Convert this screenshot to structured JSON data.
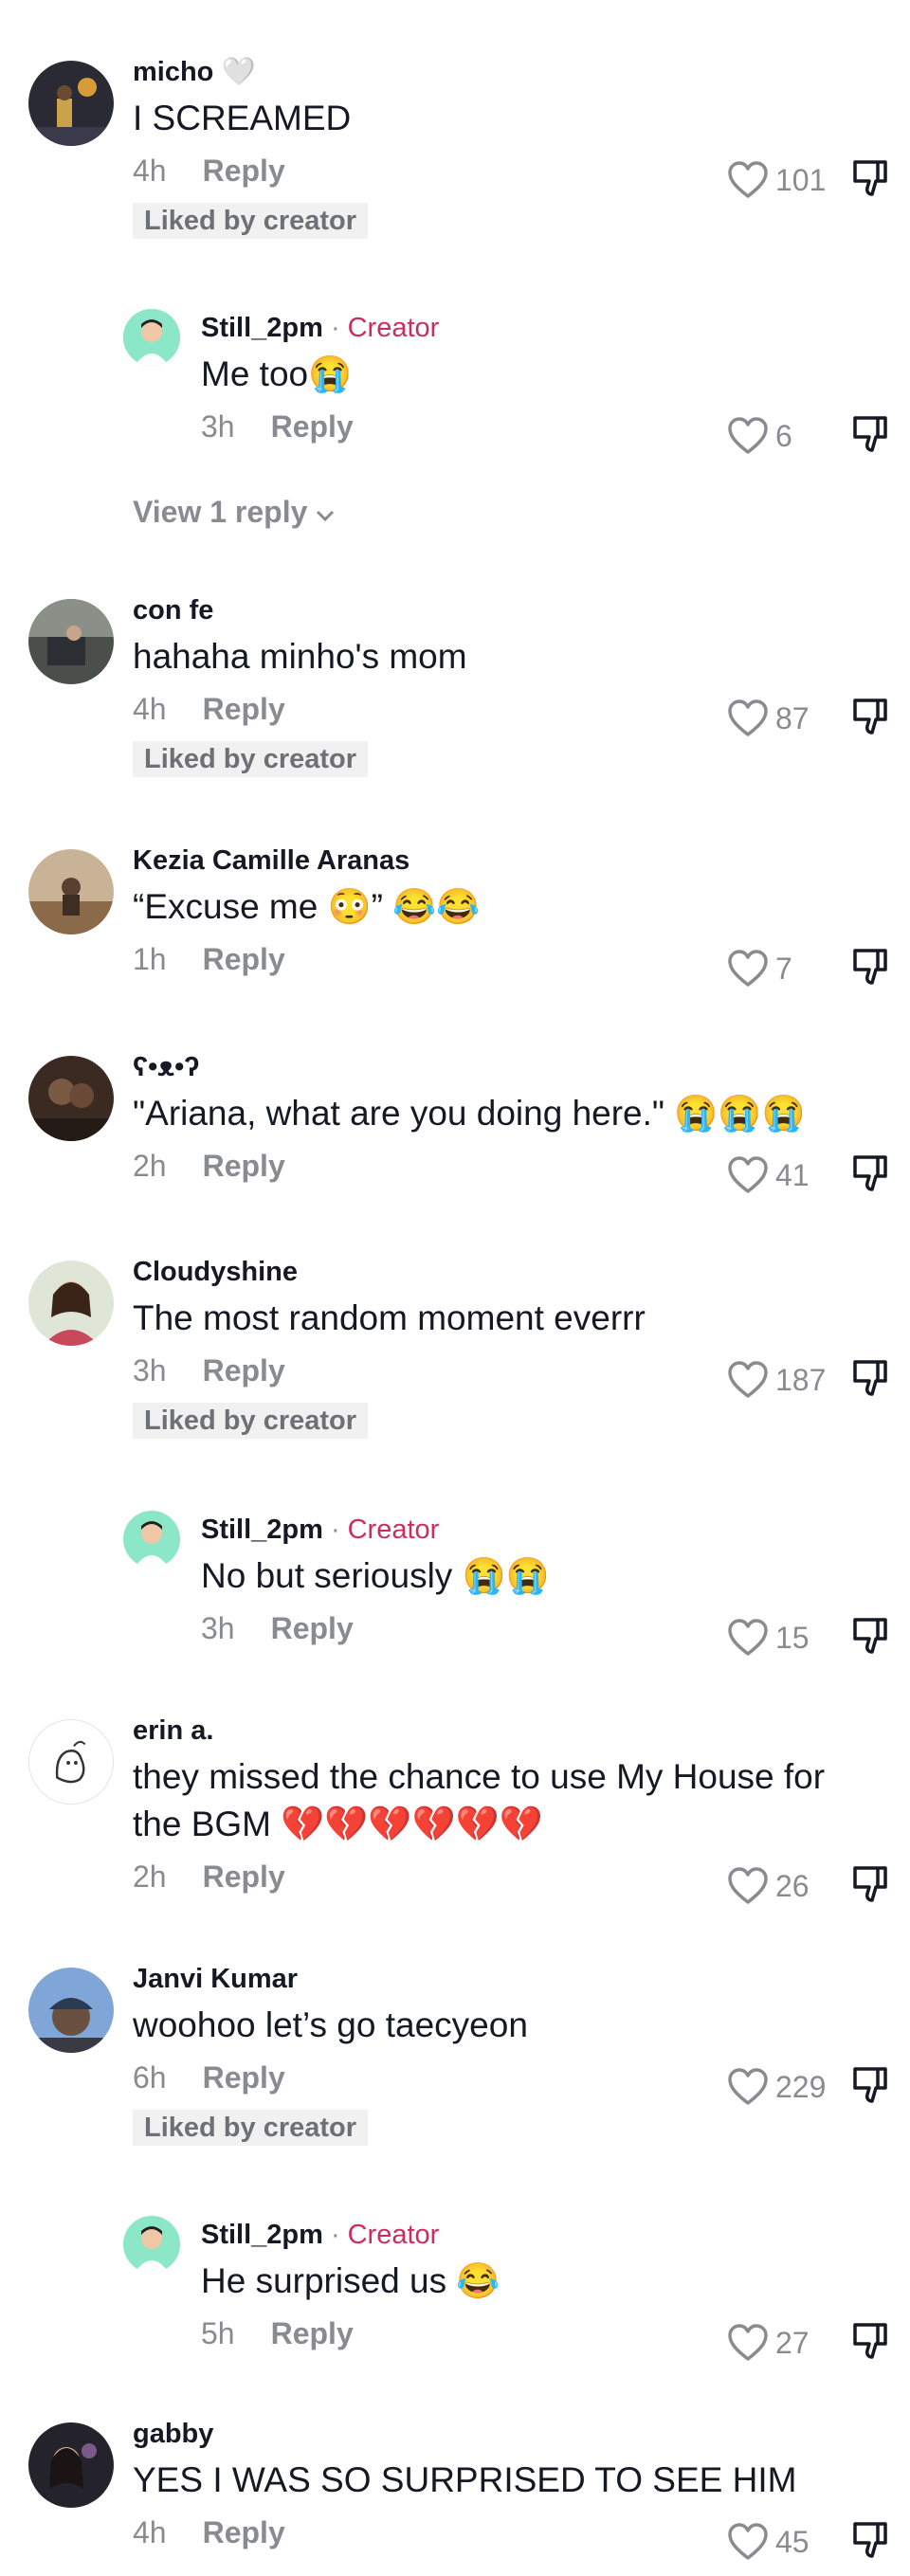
{
  "comments": [
    {
      "user": "micho",
      "user_suffix": "🤍",
      "text": "I SCREAMED",
      "time": "4h",
      "reply": "Reply",
      "likes": "101",
      "liked": "Liked by creator"
    },
    {
      "user": "Still_2pm",
      "badge": "Creator",
      "text": "Me too",
      "emoji": "😭",
      "time": "3h",
      "reply": "Reply",
      "likes": "6"
    },
    {
      "view_more": "View 1 reply"
    },
    {
      "user": "con fe",
      "text": "hahaha minho's mom",
      "time": "4h",
      "reply": "Reply",
      "likes": "87",
      "liked": "Liked by creator"
    },
    {
      "user": "Kezia Camille Aranas",
      "text": "“Excuse me 😳” 😂😂",
      "time": "1h",
      "reply": "Reply",
      "likes": "7"
    },
    {
      "user": "ʕ•ᴥ•ʔ",
      "text": "\"Ariana, what are you doing here.\" 😭😭😭",
      "time": "2h",
      "reply": "Reply",
      "likes": "41"
    },
    {
      "user": "Cloudyshine",
      "text": "The most random moment everrr",
      "time": "3h",
      "reply": "Reply",
      "likes": "187",
      "liked": "Liked by creator"
    },
    {
      "user": "Still_2pm",
      "badge": "Creator",
      "text": "No but seriously 😭😭",
      "time": "3h",
      "reply": "Reply",
      "likes": "15"
    },
    {
      "user": "erin a.",
      "text": "they missed the chance to use My House for the BGM 💔💔💔💔💔💔",
      "time": "2h",
      "reply": "Reply",
      "likes": "26"
    },
    {
      "user": "Janvi Kumar",
      "text": "woohoo let’s go taecyeon",
      "time": "6h",
      "reply": "Reply",
      "likes": "229",
      "liked": "Liked by creator"
    },
    {
      "user": "Still_2pm",
      "badge": "Creator",
      "text": "He surprised us 😂",
      "time": "5h",
      "reply": "Reply",
      "likes": "27"
    },
    {
      "user": "gabby",
      "text": "YES I WAS SO SURPRISED TO SEE HIM",
      "time": "4h",
      "reply": "Reply",
      "likes": "45"
    }
  ],
  "colors": {
    "creator_badge": "#cc2d5f",
    "secondary": "#8a8b91",
    "liked_bg": "#f1f1f2"
  },
  "icons": {
    "like": "heart-outline-icon",
    "dislike": "thumbs-down-icon",
    "expand": "chevron-down-icon"
  }
}
